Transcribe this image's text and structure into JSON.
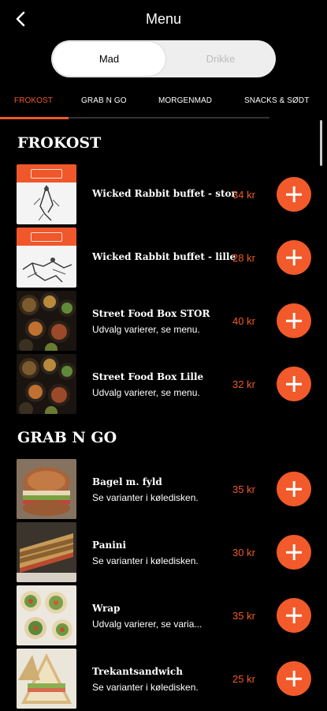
{
  "header": {
    "title": "Menu",
    "back_icon": "chevron-left-icon"
  },
  "segmented": {
    "active": "Mad",
    "inactive": "Drikke"
  },
  "tabs": [
    {
      "label": "FROKOST",
      "active": true
    },
    {
      "label": "GRAB N GO",
      "active": false
    },
    {
      "label": "MORGENMAD",
      "active": false
    },
    {
      "label": "SNACKS & SØDT",
      "active": false
    }
  ],
  "sections": [
    {
      "title": "FROKOST",
      "items": [
        {
          "name": "Wicked Rabbit buffet - stor",
          "description": "",
          "price": "34 kr"
        },
        {
          "name": "Wicked Rabbit buffet - lille",
          "description": "",
          "price": "28 kr"
        },
        {
          "name": "Street Food Box STOR",
          "description": "Udvalg varierer, se menu.",
          "price": "40 kr"
        },
        {
          "name": "Street Food Box Lille",
          "description": "Udvalg varierer, se menu.",
          "price": "32 kr"
        }
      ]
    },
    {
      "title": "GRAB N GO",
      "items": [
        {
          "name": "Bagel m. fyld",
          "description": "Se varianter i køledisken.",
          "price": "35 kr"
        },
        {
          "name": "Panini",
          "description": "Se varianter i køledisken.",
          "price": "30 kr"
        },
        {
          "name": "Wrap",
          "description": "Udvalg varierer, se varia...",
          "price": "35 kr"
        },
        {
          "name": "Trekantsandwich",
          "description": "Se varianter i køledisken.",
          "price": "25 kr"
        }
      ]
    }
  ],
  "colors": {
    "accent": "#f05a28",
    "background": "#000000"
  }
}
